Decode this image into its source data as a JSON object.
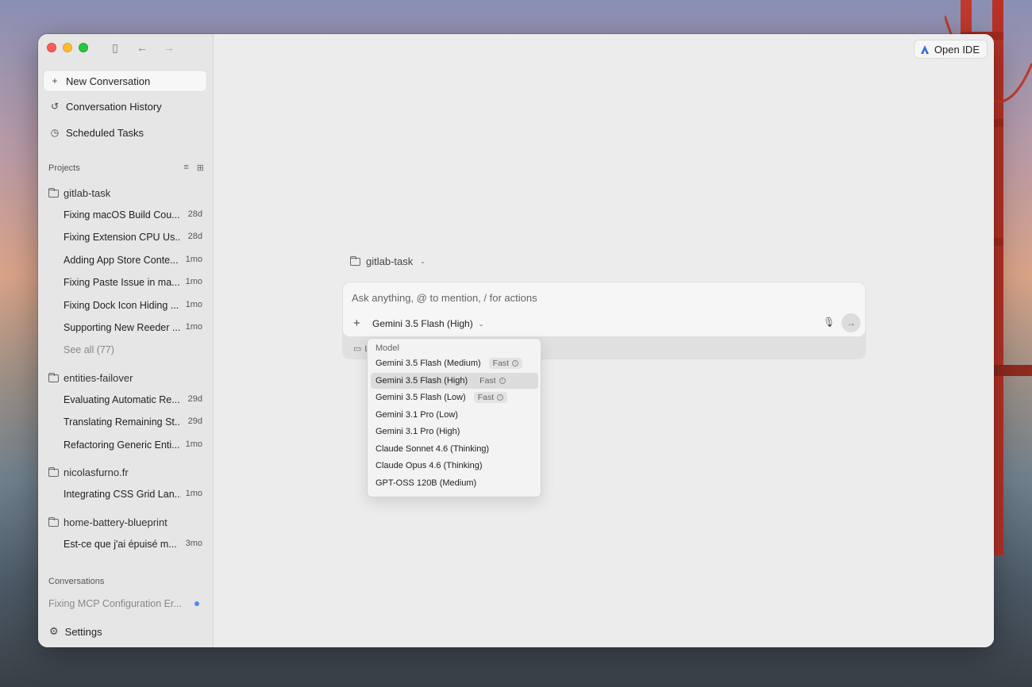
{
  "window": {
    "open_ide_label": "Open IDE"
  },
  "sidebar": {
    "new_conversation": "New Conversation",
    "conversation_history": "Conversation History",
    "scheduled_tasks": "Scheduled Tasks",
    "projects_label": "Projects",
    "projects": [
      {
        "name": "gitlab-task",
        "items": [
          {
            "title": "Fixing macOS Build Cou...",
            "age": "28d"
          },
          {
            "title": "Fixing Extension CPU Us...",
            "age": "28d"
          },
          {
            "title": "Adding App Store Conte...",
            "age": "1mo"
          },
          {
            "title": "Fixing Paste Issue in ma...",
            "age": "1mo"
          },
          {
            "title": "Fixing Dock Icon Hiding ...",
            "age": "1mo"
          },
          {
            "title": "Supporting New Reeder ...",
            "age": "1mo"
          }
        ],
        "see_all": "See all (77)"
      },
      {
        "name": "entities-failover",
        "items": [
          {
            "title": "Evaluating Automatic Re...",
            "age": "29d"
          },
          {
            "title": "Translating Remaining St...",
            "age": "29d"
          },
          {
            "title": "Refactoring Generic Enti...",
            "age": "1mo"
          }
        ]
      },
      {
        "name": "nicolasfurno.fr",
        "items": [
          {
            "title": "Integrating CSS Grid Lan...",
            "age": "1mo"
          }
        ]
      },
      {
        "name": "home-battery-blueprint",
        "items": [
          {
            "title": "Est-ce que j'ai épuisé m...",
            "age": "3mo"
          }
        ]
      }
    ],
    "conversations_label": "Conversations",
    "conversations": [
      {
        "title": "Fixing MCP Configuration Er..."
      }
    ],
    "settings": "Settings"
  },
  "main": {
    "project_selector": "gitlab-task",
    "composer": {
      "placeholder": "Ask anything, @ to mention, / for actions",
      "model": "Gemini 3.5 Flash (High)",
      "sub_label": "L"
    },
    "model_menu": {
      "header": "Model",
      "options": [
        {
          "label": "Gemini 3.5 Flash (Medium)",
          "badge": "Fast"
        },
        {
          "label": "Gemini 3.5 Flash (High)",
          "badge": "Fast",
          "selected": true
        },
        {
          "label": "Gemini 3.5 Flash (Low)",
          "badge": "Fast"
        },
        {
          "label": "Gemini 3.1 Pro (Low)"
        },
        {
          "label": "Gemini 3.1 Pro (High)"
        },
        {
          "label": "Claude Sonnet 4.6 (Thinking)"
        },
        {
          "label": "Claude Opus 4.6 (Thinking)"
        },
        {
          "label": "GPT-OSS 120B (Medium)"
        }
      ]
    }
  }
}
